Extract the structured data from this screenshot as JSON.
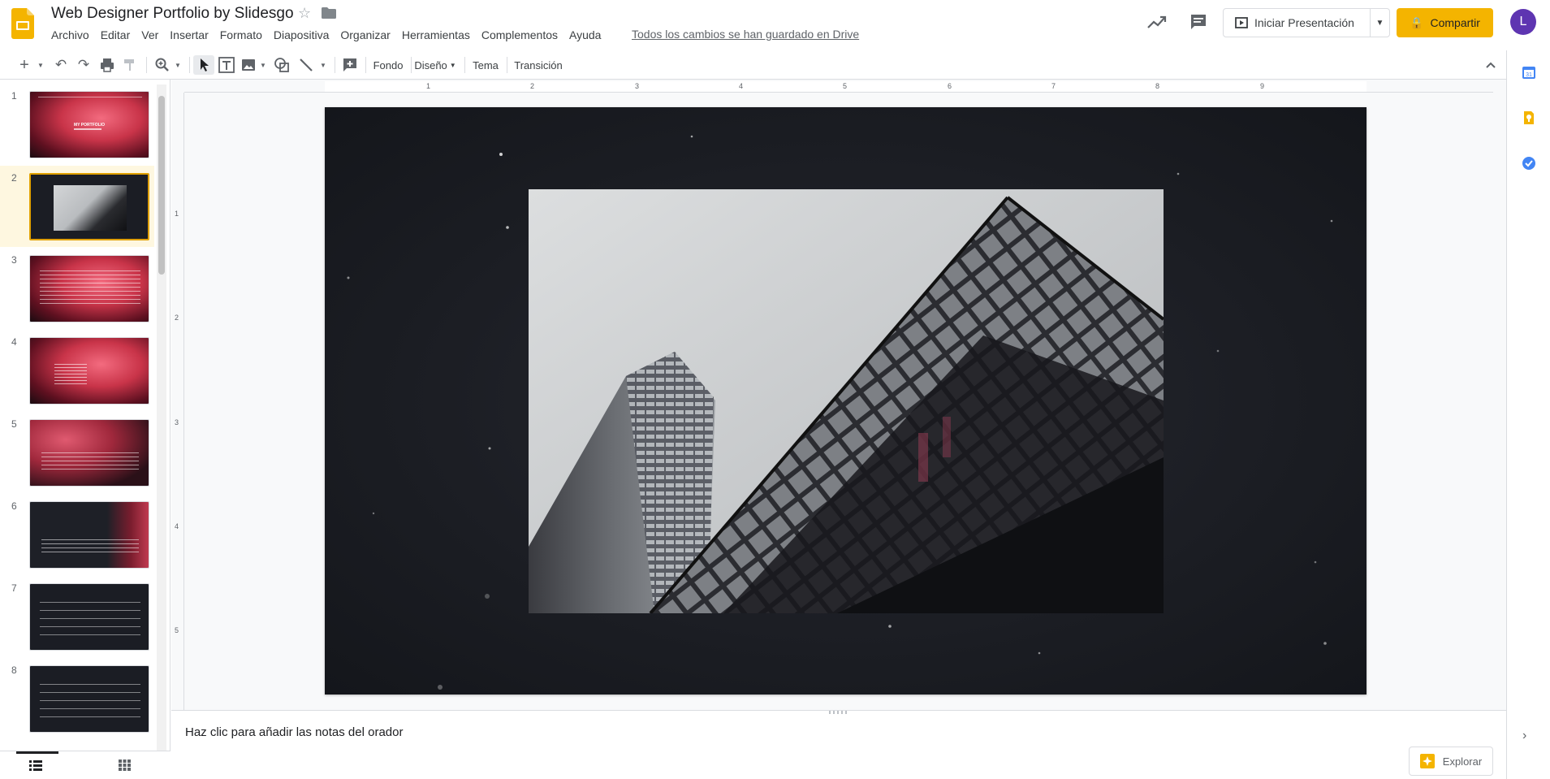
{
  "app": {
    "title": "Web Designer Portfolio by Slidesgo",
    "save_status": "Todos los cambios se han guardado en Drive",
    "accent": "#f4b400"
  },
  "menu": [
    "Archivo",
    "Editar",
    "Ver",
    "Insertar",
    "Formato",
    "Diapositiva",
    "Organizar",
    "Herramientas",
    "Complementos",
    "Ayuda"
  ],
  "header": {
    "present_label": "Iniciar Presentación",
    "share_label": "Compartir",
    "avatar_letter": "L"
  },
  "toolbar": {
    "background_label": "Fondo",
    "layout_label": "Diseño",
    "theme_label": "Tema",
    "transition_label": "Transición"
  },
  "ruler": {
    "h_ticks": [
      "1",
      "2",
      "3",
      "4",
      "5",
      "6",
      "7",
      "8",
      "9"
    ],
    "v_ticks": [
      "1",
      "2",
      "3",
      "4",
      "5"
    ]
  },
  "slides": [
    {
      "num": "1",
      "style": "red",
      "selected": false
    },
    {
      "num": "2",
      "style": "dark-photo",
      "selected": true
    },
    {
      "num": "3",
      "style": "red",
      "selected": false
    },
    {
      "num": "4",
      "style": "red",
      "selected": false
    },
    {
      "num": "5",
      "style": "red",
      "selected": false
    },
    {
      "num": "6",
      "style": "darkred",
      "selected": false
    },
    {
      "num": "7",
      "style": "dark",
      "selected": false
    },
    {
      "num": "8",
      "style": "dark",
      "selected": false
    }
  ],
  "thumbnail_text": {
    "slide1_title": "MY PORTFOLIO"
  },
  "notes": {
    "placeholder": "Haz clic para añadir las notas del orador"
  },
  "explore": {
    "label": "Explorar"
  }
}
